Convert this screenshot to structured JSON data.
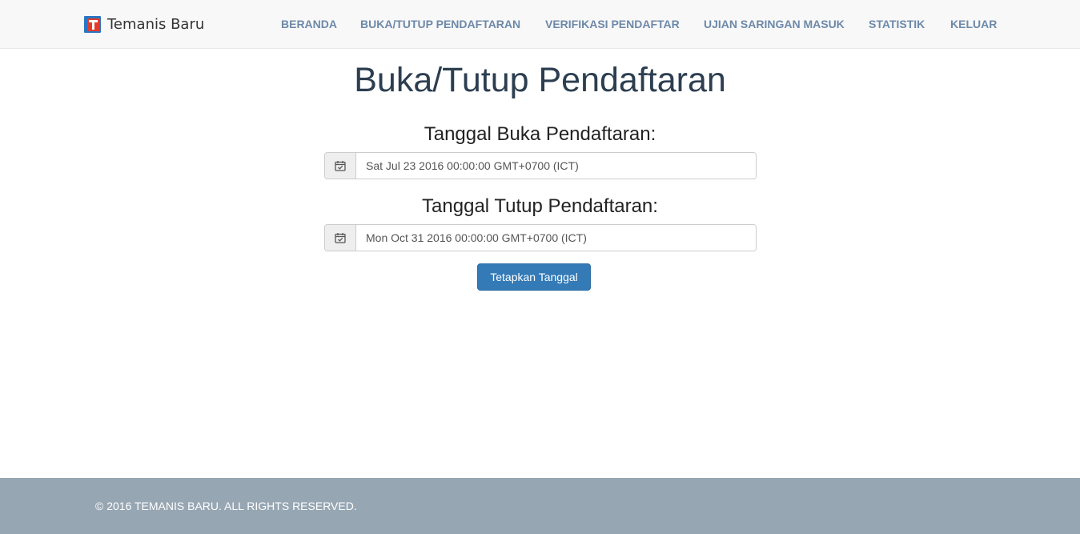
{
  "brand": {
    "name": "Temanis Baru"
  },
  "nav": {
    "items": [
      {
        "label": "BERANDA"
      },
      {
        "label": "BUKA/TUTUP PENDAFTARAN"
      },
      {
        "label": "VERIFIKASI PENDAFTAR"
      },
      {
        "label": "UJIAN SARINGAN MASUK"
      },
      {
        "label": "STATISTIK"
      },
      {
        "label": "KELUAR"
      }
    ]
  },
  "main": {
    "title": "Buka/Tutup Pendaftaran",
    "open": {
      "label": "Tanggal Buka Pendaftaran:",
      "value": "Sat Jul 23 2016 00:00:00 GMT+0700 (ICT)"
    },
    "close": {
      "label": "Tanggal Tutup Pendaftaran:",
      "value": "Mon Oct 31 2016 00:00:00 GMT+0700 (ICT)"
    },
    "submit_label": "Tetapkan Tanggal"
  },
  "footer": {
    "text": "© 2016 TEMANIS BARU. ALL RIGHTS RESERVED."
  },
  "colors": {
    "primary": "#337ab7",
    "nav_link": "#6d89a9",
    "footer_bg": "#97a6b3",
    "title": "#2c3e50"
  },
  "icons": {
    "date_addon": "calendar-check-icon"
  }
}
